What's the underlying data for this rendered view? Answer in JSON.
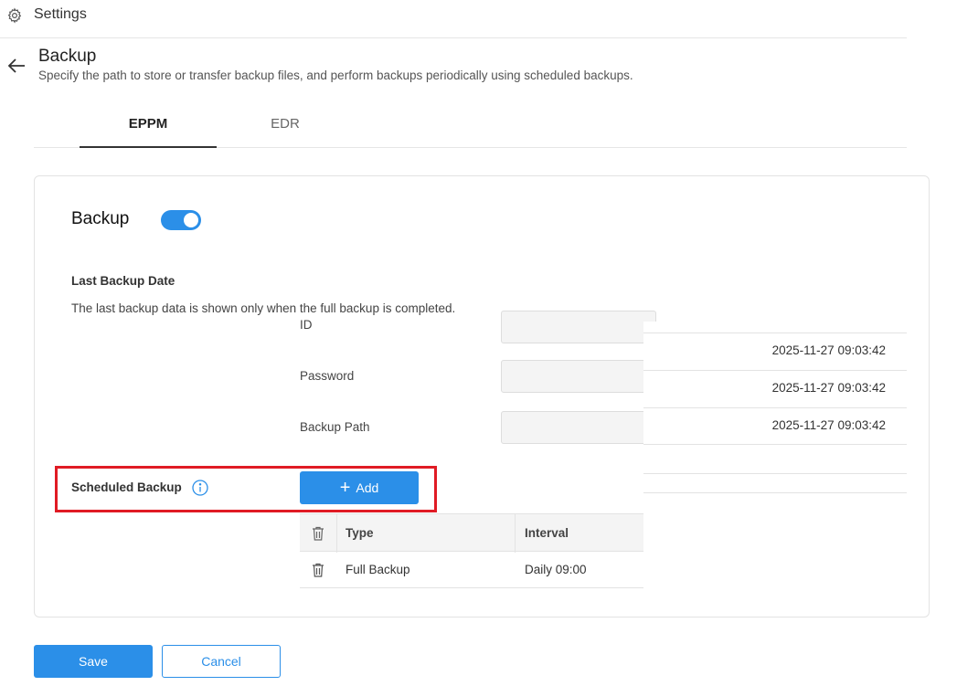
{
  "header": {
    "title": "Settings",
    "icon": "gear-icon"
  },
  "page": {
    "title": "Backup",
    "subtitle": "Specify the path to store or transfer backup files, and perform backups periodically using scheduled backups."
  },
  "tabs": [
    {
      "label": "EPPM",
      "active": true
    },
    {
      "label": "EDR",
      "active": false
    }
  ],
  "backup": {
    "title": "Backup",
    "enabled": true,
    "last_backup_label": "Last Backup Date",
    "last_backup_note": "The last backup data is shown only when the full backup is completed.",
    "fields": [
      {
        "label": "ID",
        "value": ""
      },
      {
        "label": "Password",
        "value": ""
      },
      {
        "label": "Backup Path",
        "value": ""
      }
    ],
    "dates": [
      "2025-11-27 09:03:42",
      "2025-11-27 09:03:42",
      "2025-11-27 09:03:42"
    ]
  },
  "scheduled": {
    "label": "Scheduled Backup",
    "add_label": "Add",
    "columns": [
      "Type",
      "Interval"
    ],
    "rows": [
      {
        "type": "Full Backup",
        "interval": "Daily 09:00"
      }
    ]
  },
  "actions": {
    "save": "Save",
    "cancel": "Cancel"
  },
  "colors": {
    "accent": "#2b8fe8",
    "highlight": "#e01b24"
  }
}
